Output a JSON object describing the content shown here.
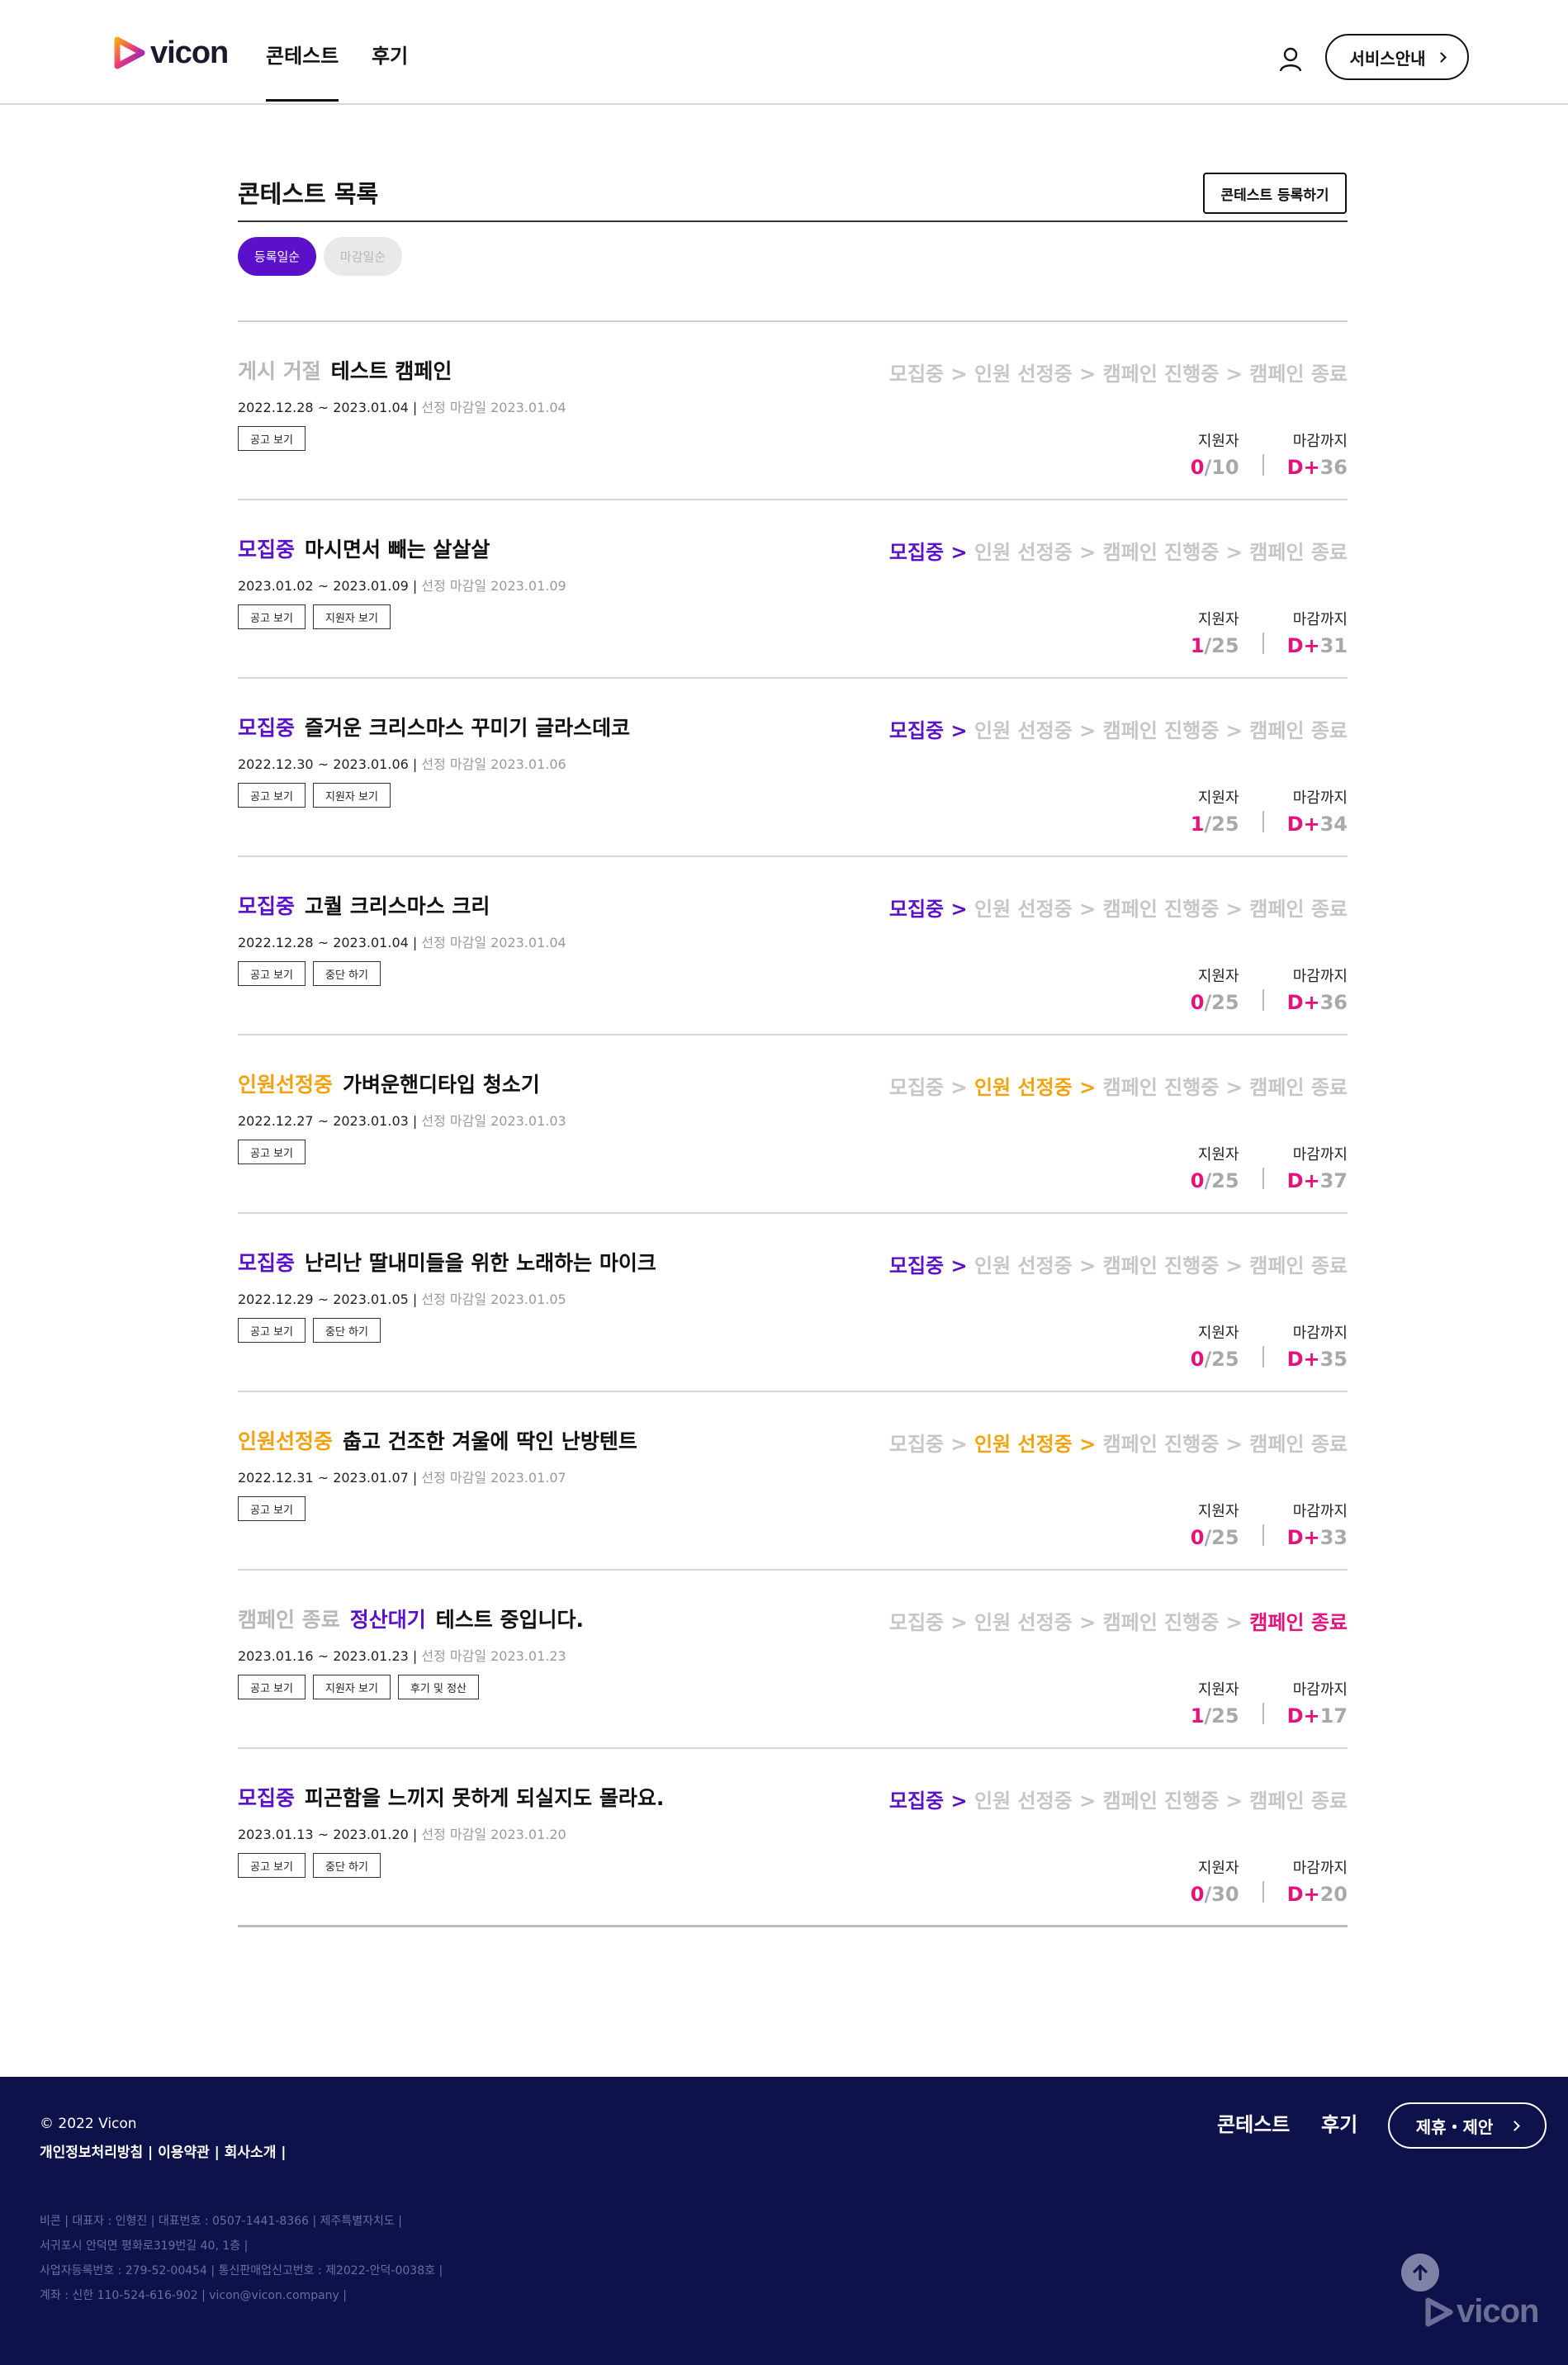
{
  "header": {
    "logo_text": "vicon",
    "tabs": [
      "콘테스트",
      "후기"
    ],
    "service_button": "서비스안내"
  },
  "list": {
    "title": "콘테스트 목록",
    "register_button": "콘테스트 등록하기",
    "sort_options": [
      "등록일순",
      "마감일순"
    ],
    "progress_steps": [
      "모집중",
      "인원 선정중",
      "캠페인 진행중",
      "캠페인 종료"
    ],
    "stat_labels": [
      "지원자",
      "마감까지"
    ],
    "items": [
      {
        "status": "게시 거절",
        "status_color": "#b8b8b8",
        "status2": "",
        "name": "테스트 캠페인",
        "period": "2022.12.28 ~ 2023.01.04",
        "deadline": "선정 마감일 2023.01.04",
        "buttons": [
          "공고 보기"
        ],
        "active_step": -1,
        "applicants": "0",
        "capacity": "10",
        "dday": "D+36"
      },
      {
        "status": "모집중",
        "status_color": "#5b10c9",
        "status2": "",
        "name": "마시면서 빼는 살살살",
        "period": "2023.01.02 ~ 2023.01.09",
        "deadline": "선정 마감일 2023.01.09",
        "buttons": [
          "공고 보기",
          "지원자 보기"
        ],
        "active_step": 0,
        "applicants": "1",
        "capacity": "25",
        "dday": "D+31"
      },
      {
        "status": "모집중",
        "status_color": "#5b10c9",
        "status2": "",
        "name": "즐거운 크리스마스 꾸미기 글라스데코",
        "period": "2022.12.30 ~ 2023.01.06",
        "deadline": "선정 마감일 2023.01.06",
        "buttons": [
          "공고 보기",
          "지원자 보기"
        ],
        "active_step": 0,
        "applicants": "1",
        "capacity": "25",
        "dday": "D+34"
      },
      {
        "status": "모집중",
        "status_color": "#5b10c9",
        "status2": "",
        "name": "고퀄 크리스마스 크리",
        "period": "2022.12.28 ~ 2023.01.04",
        "deadline": "선정 마감일 2023.01.04",
        "buttons": [
          "공고 보기",
          "중단 하기"
        ],
        "active_step": 0,
        "applicants": "0",
        "capacity": "25",
        "dday": "D+36"
      },
      {
        "status": "인원선정중",
        "status_color": "#f2a20f",
        "status2": "",
        "name": "가벼운핸디타입 청소기",
        "period": "2022.12.27 ~ 2023.01.03",
        "deadline": "선정 마감일 2023.01.03",
        "buttons": [
          "공고 보기"
        ],
        "active_step": 1,
        "applicants": "0",
        "capacity": "25",
        "dday": "D+37"
      },
      {
        "status": "모집중",
        "status_color": "#5b10c9",
        "status2": "",
        "name": "난리난 딸내미들을 위한 노래하는 마이크",
        "period": "2022.12.29 ~ 2023.01.05",
        "deadline": "선정 마감일 2023.01.05",
        "buttons": [
          "공고 보기",
          "중단 하기"
        ],
        "active_step": 0,
        "applicants": "0",
        "capacity": "25",
        "dday": "D+35"
      },
      {
        "status": "인원선정중",
        "status_color": "#f2a20f",
        "status2": "",
        "name": "춥고 건조한 겨울에 딱인 난방텐트",
        "period": "2022.12.31 ~ 2023.01.07",
        "deadline": "선정 마감일 2023.01.07",
        "buttons": [
          "공고 보기"
        ],
        "active_step": 1,
        "applicants": "0",
        "capacity": "25",
        "dday": "D+33"
      },
      {
        "status": "캠페인 종료",
        "status_color": "#b8b8b8",
        "status2": "정산대기",
        "name": "테스트 중입니다.",
        "period": "2023.01.16 ~ 2023.01.23",
        "deadline": "선정 마감일 2023.01.23",
        "buttons": [
          "공고 보기",
          "지원자 보기",
          "후기 및 정산"
        ],
        "active_step": 3,
        "applicants": "1",
        "capacity": "25",
        "dday": "D+17"
      },
      {
        "status": "모집중",
        "status_color": "#5b10c9",
        "status2": "",
        "name": "피곤함을 느끼지 못하게 되실지도 몰라요.",
        "period": "2023.01.13 ~ 2023.01.20",
        "deadline": "선정 마감일 2023.01.20",
        "buttons": [
          "공고 보기",
          "중단 하기"
        ],
        "active_step": 0,
        "applicants": "0",
        "capacity": "30",
        "dday": "D+20"
      }
    ],
    "step_colors": [
      "#5b10c9",
      "#f2a20f",
      "#5b10c9",
      "#e4127c"
    ],
    "status2_color": "#5b10c9"
  },
  "footer": {
    "copyright": "© 2022 Vicon",
    "policy": "개인정보처리방침 | 이용약관 | 회사소개 |",
    "info": [
      "비콘 | 대표자 : 인형진 | 대표번호 : 0507-1441-8366 | 제주특별자치도 |",
      "서귀포시 안덕면 평화로319번길 40, 1층 |",
      "사업자등록번호 : 279-52-00454 | 통신판매업신고번호 : 제2022-안덕-0038호 |",
      "계좌 : 신한 110-524-616-902 | vicon@vicon.company |"
    ],
    "nav": [
      "콘테스트",
      "후기"
    ],
    "partner_button": "제휴・제안",
    "logo_text": "vicon"
  }
}
